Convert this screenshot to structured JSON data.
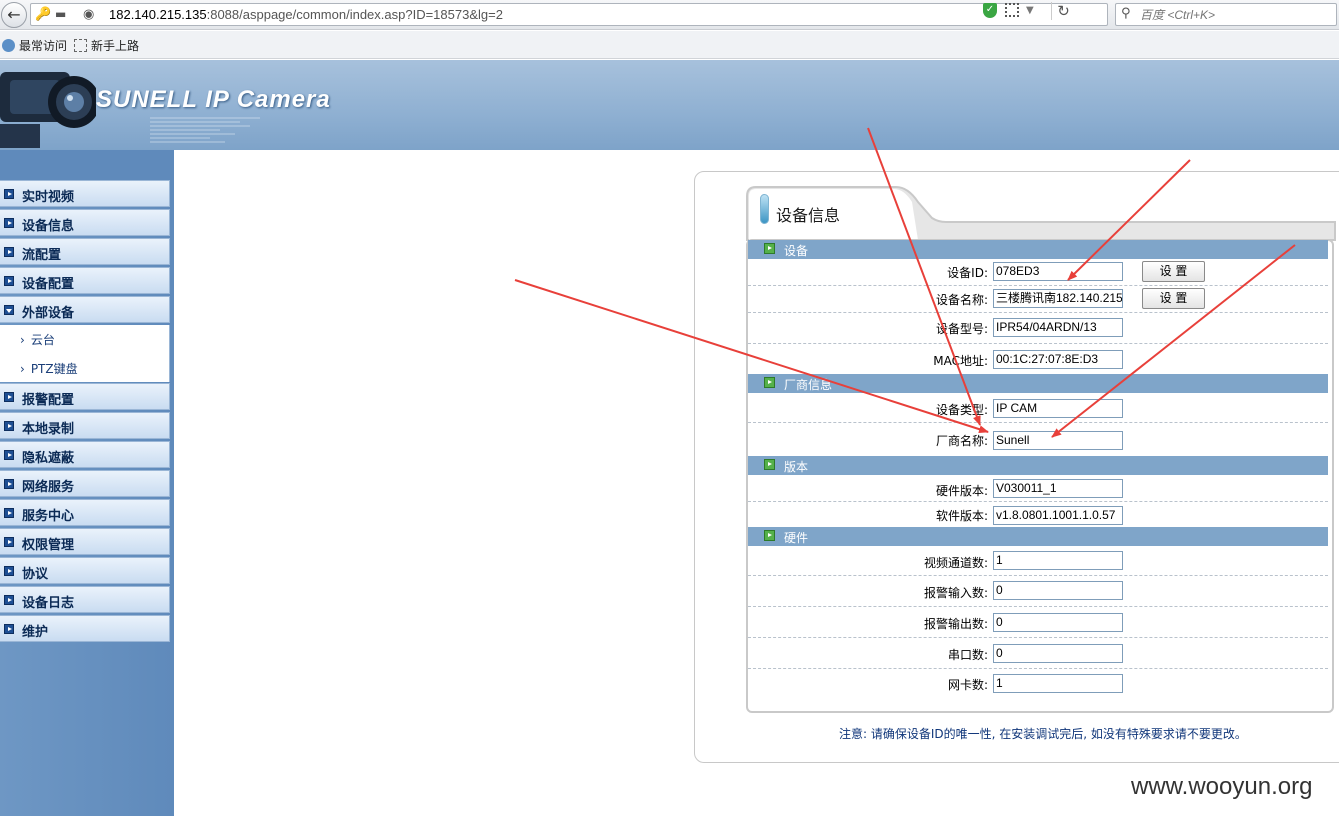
{
  "browser": {
    "url_host": "182.140.215.135",
    "url_rest": ":8088/asppage/common/index.asp?ID=18573&lg=2",
    "search_placeholder": "百度 <Ctrl+K>",
    "bookmarks": [
      "最常访问",
      "新手上路"
    ]
  },
  "header": {
    "brand": "SUNELL IP Camera"
  },
  "sidebar": {
    "items": [
      "实时视频",
      "设备信息",
      "流配置",
      "设备配置",
      "外部设备",
      "报警配置",
      "本地录制",
      "隐私遮蔽",
      "网络服务",
      "服务中心",
      "权限管理",
      "协议",
      "设备日志",
      "维护"
    ],
    "subitems": [
      "云台",
      "PTZ键盘"
    ]
  },
  "panel": {
    "title": "设备信息",
    "sections": {
      "device": "设备",
      "vendor": "厂商信息",
      "version": "版本",
      "hardware": "硬件"
    },
    "fields": {
      "device_id": {
        "label": "设备ID:",
        "value": "078ED3"
      },
      "device_name": {
        "label": "设备名称:",
        "value": "三楼腾讯南182.140.215"
      },
      "device_model": {
        "label": "设备型号:",
        "value": "IPR54/04ARDN/13"
      },
      "mac": {
        "label": "MAC地址:",
        "value": "00:1C:27:07:8E:D3"
      },
      "device_type": {
        "label": "设备类型:",
        "value": "IP CAM"
      },
      "vendor_name": {
        "label": "厂商名称:",
        "value": "Sunell"
      },
      "hw_version": {
        "label": "硬件版本:",
        "value": "V030011_1"
      },
      "sw_version": {
        "label": "软件版本:",
        "value": "v1.8.0801.1001.1.0.57"
      },
      "video_channels": {
        "label": "视频通道数:",
        "value": "1"
      },
      "alarm_in": {
        "label": "报警输入数:",
        "value": "0"
      },
      "alarm_out": {
        "label": "报警输出数:",
        "value": "0"
      },
      "serial_ports": {
        "label": "串口数:",
        "value": "0"
      },
      "nic_count": {
        "label": "网卡数:",
        "value": "1"
      }
    },
    "set_button": "设 置",
    "note": "注意: 请确保设备ID的唯一性, 在安装调试完后, 如没有特殊要求请不要更改。"
  },
  "watermark": "www.wooyun.org",
  "colors": {
    "banner": "#8fb0d2",
    "sidebar": "#5f8abb",
    "section_bar": "#7fa5c9",
    "annotation_arrow": "#e8403a"
  }
}
